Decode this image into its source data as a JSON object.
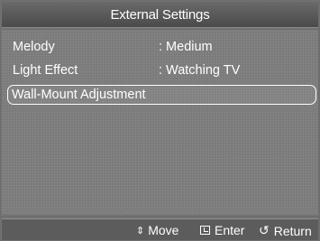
{
  "header": {
    "title": "External Settings"
  },
  "menu": {
    "items": [
      {
        "label": "Melody",
        "value": ": Medium"
      },
      {
        "label": "Light Effect",
        "value": ": Watching TV"
      },
      {
        "label": "Wall-Mount Adjustment",
        "value": ""
      }
    ]
  },
  "footer": {
    "move_label": "Move",
    "enter_label": "Enter",
    "return_label": "Return",
    "move_glyph": "⇕",
    "return_glyph": "↺"
  }
}
